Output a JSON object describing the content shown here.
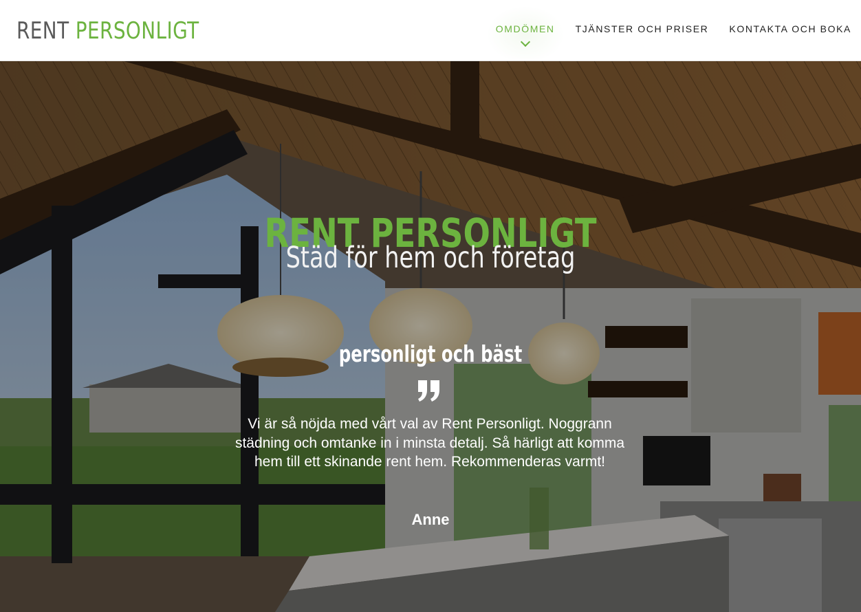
{
  "header": {
    "logo_word1": "RENT",
    "logo_word2": "PERSONLIGT",
    "nav": [
      {
        "label": "OMDÖMEN",
        "active": true
      },
      {
        "label": "TJÄNSTER OCH PRISER",
        "active": false
      },
      {
        "label": "KONTAKTA OCH BOKA",
        "active": false
      }
    ]
  },
  "hero": {
    "title": "RENT PERSONLIGT",
    "subtitle": "Städ för hem och företag"
  },
  "testimonial": {
    "heading": "personligt och bäst",
    "quote_icon": "quote-icon",
    "text": "Vi är så nöjda med vårt val av Rent Personligt. Noggrann städning och omtanke in i minsta detalj. Så härligt att komma hem till ett skinande rent hem. Rekommenderas varmt!",
    "author": "Anne"
  },
  "colors": {
    "brand_green": "#6cb33f",
    "logo_gray": "#5a5a5a",
    "nav_text": "#222222"
  }
}
